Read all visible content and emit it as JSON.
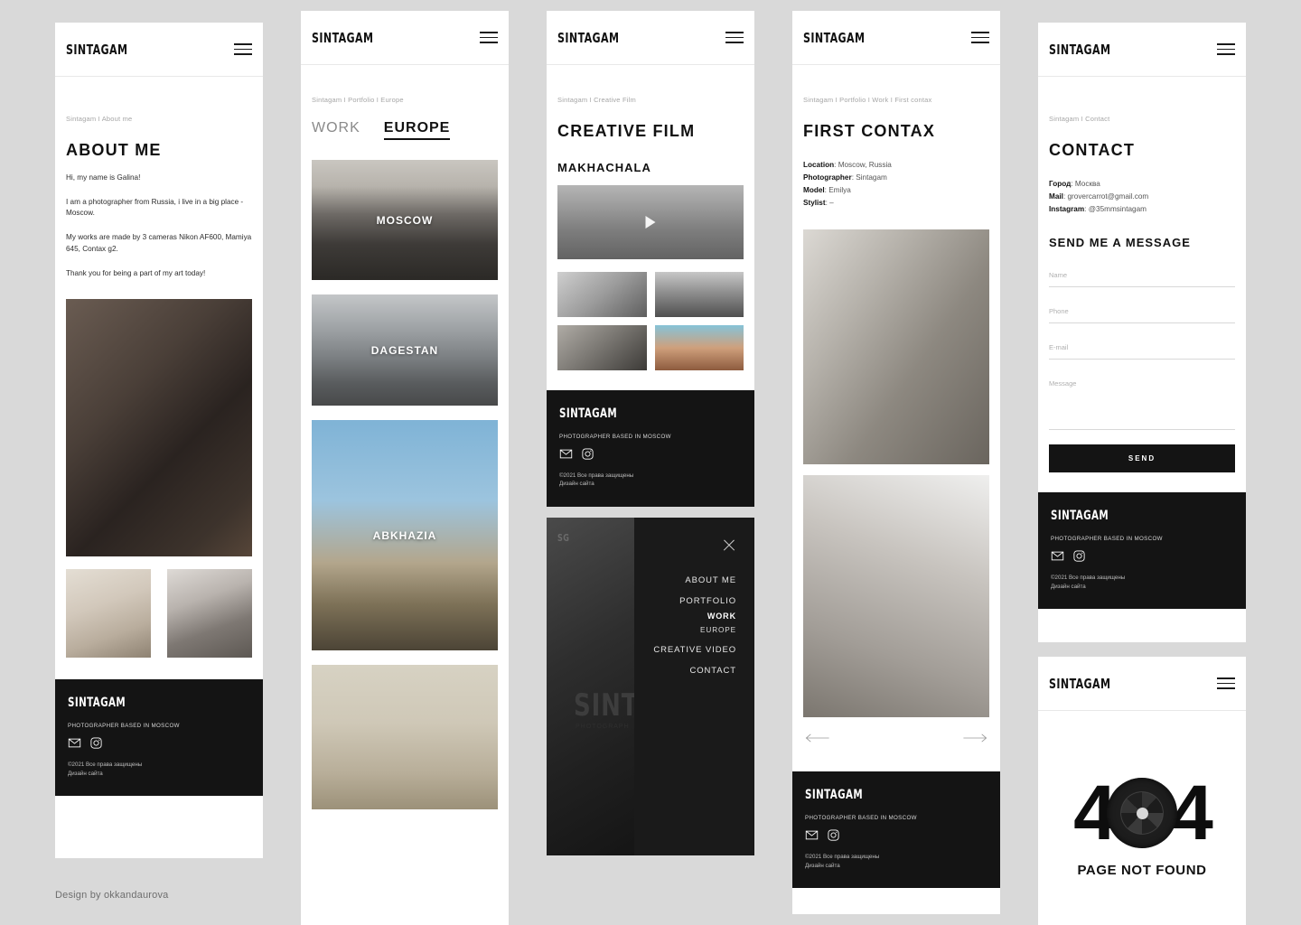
{
  "brand": {
    "logo": "SINTAGAM",
    "menu_icon": "hamburger-icon"
  },
  "footer": {
    "logo": "SINTAGAM",
    "tagline": "PHOTOGRAPHER BASED IN MOSCOW",
    "copyright": "©2021 Все права защищены",
    "design_link": "Дизайн сайта",
    "icons": [
      "mail-icon",
      "instagram-icon"
    ]
  },
  "credit": "Design by okkandaurova",
  "panel_about": {
    "breadcrumb": "Sintagam I About me",
    "title": "ABOUT ME",
    "paragraphs": [
      "Hi, my name is Galina!",
      "I am a photographer from Russia, i live in a big place - Moscow.",
      "My works are made by 3 cameras Nikon AF600, Mamiya 645, Contax g2.",
      "Thank you for being a part of my art today!"
    ]
  },
  "panel_work": {
    "breadcrumb": "Sintagam I Portfolio I Europe",
    "tabs": [
      {
        "label": "WORK",
        "active": false
      },
      {
        "label": "EUROPE",
        "active": true
      }
    ],
    "gallery": [
      {
        "caption": "MOSCOW"
      },
      {
        "caption": "DAGESTAN"
      },
      {
        "caption": "ABKHAZIA"
      },
      {
        "caption": ""
      }
    ]
  },
  "panel_film": {
    "breadcrumb": "Sintagam I Creative Film",
    "title": "CREATIVE FILM",
    "subtitle": "MAKHACHALA",
    "play_icon": "play-icon",
    "thumbnails": [
      "thumb-bed",
      "thumb-beach",
      "thumb-room",
      "thumb-hair"
    ]
  },
  "panel_contax": {
    "breadcrumb": "Sintagam I Portfolio I Work I First contax",
    "title": "FIRST CONTAX",
    "meta": [
      {
        "key": "Location",
        "value": "Moscow, Russia"
      },
      {
        "key": "Photographer",
        "value": "Sintagam"
      },
      {
        "key": "Model",
        "value": "Emilya"
      },
      {
        "key": "Stylist",
        "value": "–"
      }
    ],
    "prev_icon": "arrow-left-icon",
    "next_icon": "arrow-right-icon"
  },
  "panel_contact": {
    "breadcrumb": "Sintagam I Contact",
    "title": "CONTACT",
    "details": [
      {
        "key": "Город",
        "value": "Москва"
      },
      {
        "key": "Mail",
        "value": "grovercarrot@gmail.com"
      },
      {
        "key": "Instagram",
        "value": "@35mmsintagam"
      }
    ],
    "form_title": "SEND ME A MESSAGE",
    "fields": [
      {
        "placeholder": "Name",
        "value": ""
      },
      {
        "placeholder": "Phone",
        "value": ""
      },
      {
        "placeholder": "E-mail",
        "value": ""
      },
      {
        "placeholder": "Message",
        "value": ""
      }
    ],
    "submit_label": "SEND"
  },
  "panel_404": {
    "digit_left": "4",
    "digit_right": "4",
    "lens_icon": "camera-lens-icon",
    "message": "PAGE NOT FOUND"
  },
  "menu_overlay": {
    "close_icon": "close-icon",
    "watermark_logo": "SG",
    "watermark_big": "SINT",
    "watermark_small": "PHOTOGRAPH",
    "items": [
      {
        "label": "ABOUT ME",
        "style": "normal"
      },
      {
        "label": "PORTFOLIO",
        "style": "normal"
      },
      {
        "label": "WORK",
        "style": "bold"
      },
      {
        "label": "EUROPE",
        "style": "small"
      },
      {
        "label": "CREATIVE VIDEO",
        "style": "normal"
      },
      {
        "label": "CONTACT",
        "style": "normal"
      }
    ]
  },
  "colors": {
    "page_bg": "#d9d9d9",
    "ink": "#111111",
    "dark": "#141414",
    "muted": "#a6a6a6"
  }
}
